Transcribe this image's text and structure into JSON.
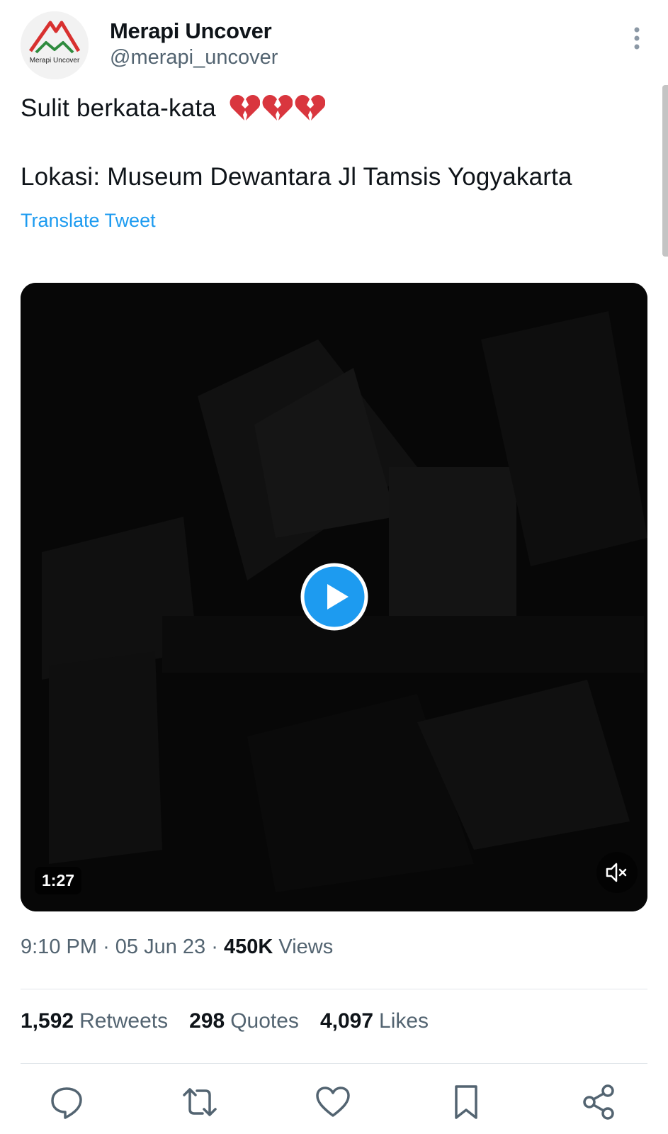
{
  "account": {
    "display_name": "Merapi Uncover",
    "handle": "@merapi_uncover",
    "avatar_text": "Merapi Uncover"
  },
  "tweet": {
    "line1": "Sulit berkata-kata",
    "line1_emojis": [
      "broken-heart",
      "broken-heart",
      "broken-heart"
    ],
    "line2": "Lokasi: Museum Dewantara Jl Tamsis Yogyakarta",
    "translate_label": "Translate Tweet"
  },
  "video": {
    "duration": "1:27",
    "muted": true
  },
  "meta": {
    "time": "9:10 PM",
    "separator": "·",
    "date": "05 Jun 23",
    "views_count": "450K",
    "views_label": "Views"
  },
  "stats": {
    "retweets_count": "1,592",
    "retweets_label": "Retweets",
    "quotes_count": "298",
    "quotes_label": "Quotes",
    "likes_count": "4,097",
    "likes_label": "Likes"
  },
  "actions": [
    "reply-icon",
    "retweet-icon",
    "like-icon",
    "bookmark-icon",
    "share-icon"
  ],
  "colors": {
    "link": "#1d9bf0",
    "text_primary": "#0f1419",
    "text_secondary": "#536471",
    "play_button": "#1d9bf0",
    "logo_red": "#d8302f",
    "logo_green": "#2e8b3e"
  }
}
